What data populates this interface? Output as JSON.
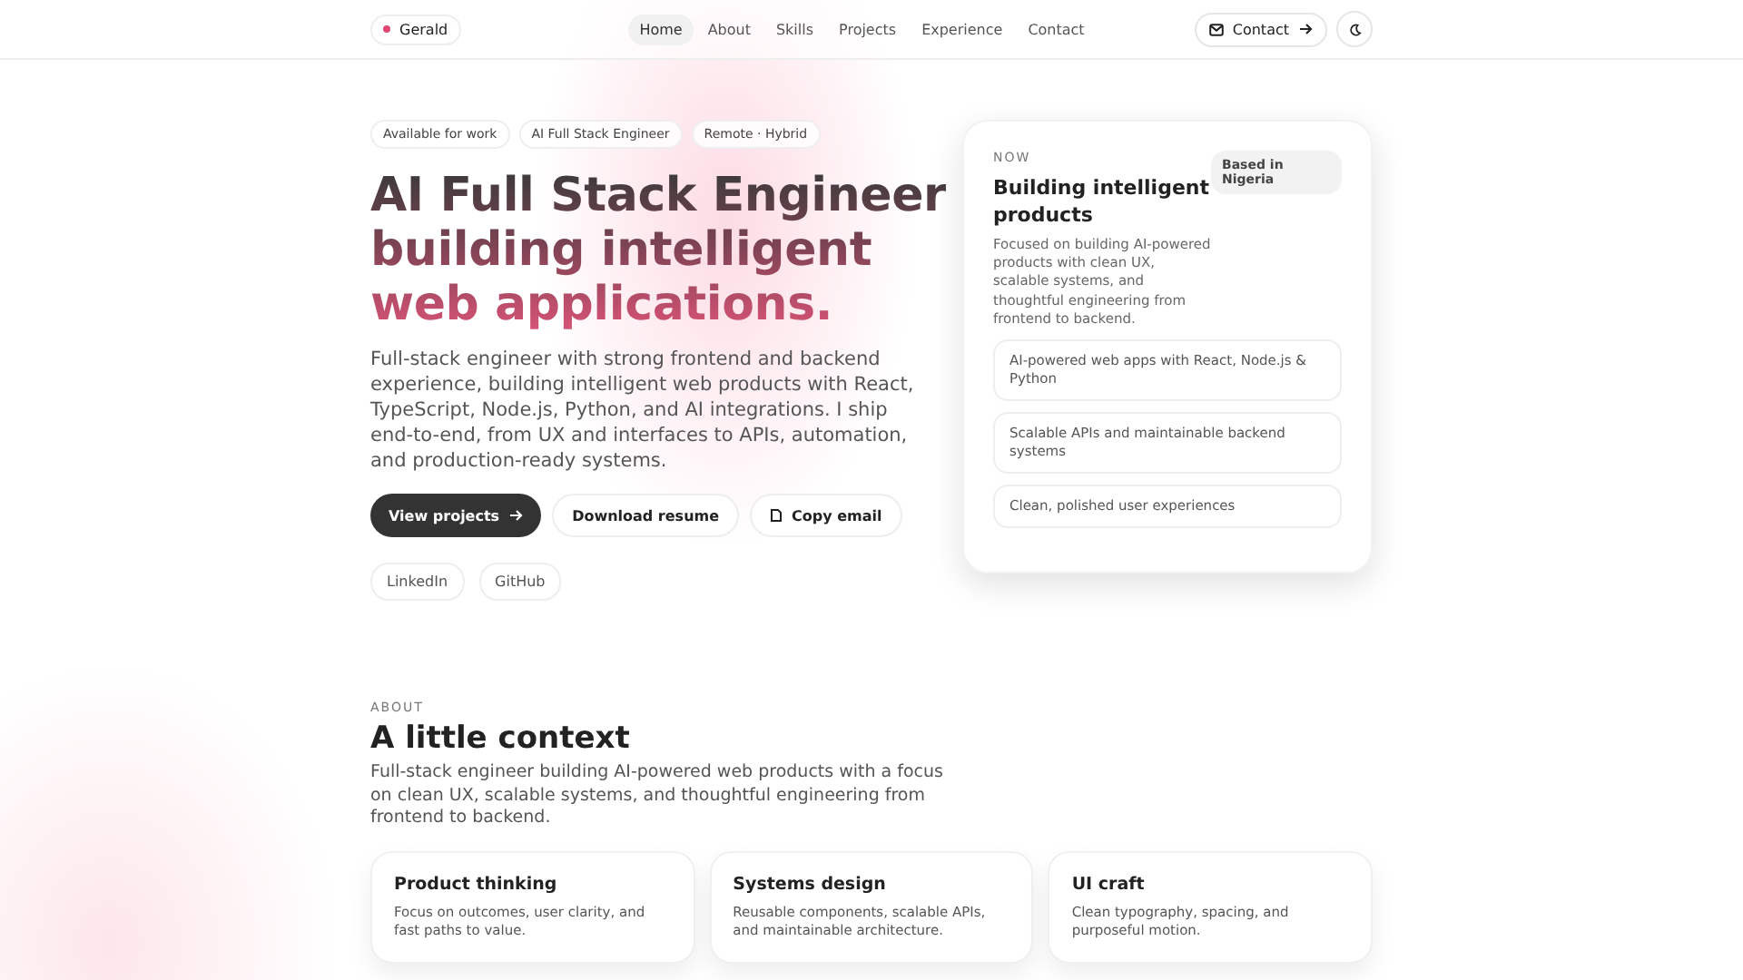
{
  "header": {
    "brand": "Gerald",
    "nav": [
      {
        "label": "Home",
        "selected": true
      },
      {
        "label": "About",
        "selected": false
      },
      {
        "label": "Skills",
        "selected": false
      },
      {
        "label": "Projects",
        "selected": false
      },
      {
        "label": "Experience",
        "selected": false
      },
      {
        "label": "Contact",
        "selected": false
      }
    ],
    "contact_button": "Contact"
  },
  "hero": {
    "tags": [
      "Available for work",
      "AI Full Stack Engineer",
      "Remote · Hybrid"
    ],
    "headline": [
      "AI Full Stack Engineer",
      "building intelligent",
      "web applications."
    ],
    "intro": "Full-stack engineer with strong frontend and backend experience, building intelligent web products with React, TypeScript, Node.js, Python, and AI integrations. I ship end-to-end, from UX and interfaces to APIs, automation, and production-ready systems.",
    "buttons": [
      {
        "label": "View projects",
        "kind": "primary"
      },
      {
        "label": "Download resume",
        "kind": "secondary"
      },
      {
        "label": "Copy email",
        "kind": "copy"
      }
    ],
    "links": [
      "LinkedIn",
      "GitHub"
    ]
  },
  "now_card": {
    "eyebrow": "NOW",
    "title": "Building intelligent products",
    "badge": "Based in Nigeria",
    "description": "Focused on building AI-powered products with clean UX, scalable systems, and thoughtful engineering from frontend to backend.",
    "items": [
      "AI-powered web apps with React, Node.js & Python",
      "Scalable APIs and maintainable backend systems",
      "Clean, polished user experiences"
    ]
  },
  "about": {
    "eyebrow": "ABOUT",
    "title": "A little context",
    "description": "Full-stack engineer building AI-powered web products with a focus on clean UX, scalable systems, and thoughtful engineering from frontend to backend.",
    "cards": [
      {
        "title": "Product thinking",
        "text": "Focus on outcomes, user clarity, and fast paths to value."
      },
      {
        "title": "Systems design",
        "text": "Reusable components, scalable APIs, and maintainable architecture."
      },
      {
        "title": "UI craft",
        "text": "Clean typography, spacing, and purposeful motion."
      }
    ]
  }
}
